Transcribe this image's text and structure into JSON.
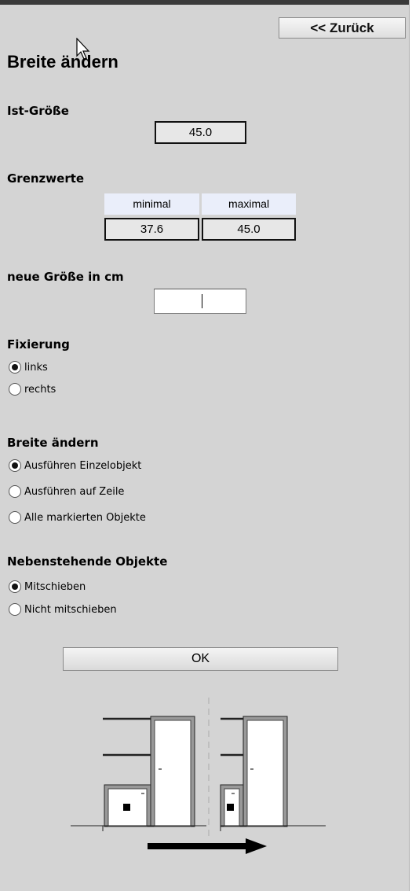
{
  "back_button": "<< Zurück",
  "title": "Breite ändern",
  "ist_size": {
    "label": "Ist-Größe",
    "value": "45.0"
  },
  "limits": {
    "label": "Grenzwerte",
    "min_header": "minimal",
    "max_header": "maximal",
    "min_value": "37.6",
    "max_value": "45.0"
  },
  "new_size": {
    "label": "neue Größe in cm",
    "value": ""
  },
  "fixierung": {
    "label": "Fixierung",
    "options": [
      "links",
      "rechts"
    ],
    "selected": "links"
  },
  "breite_aendern": {
    "label": "Breite ändern",
    "options": [
      "Ausführen Einzelobjekt",
      "Ausführen auf Zeile",
      "Alle markierten Objekte"
    ],
    "selected": "Ausführen Einzelobjekt"
  },
  "nebenstehende": {
    "label": "Nebenstehende Objekte",
    "options": [
      "Mitschieben",
      "Nicht mitschieben"
    ],
    "selected": "Mitschieben"
  },
  "ok_button": "OK",
  "illustration_icon": "cabinet-resize-diagram"
}
